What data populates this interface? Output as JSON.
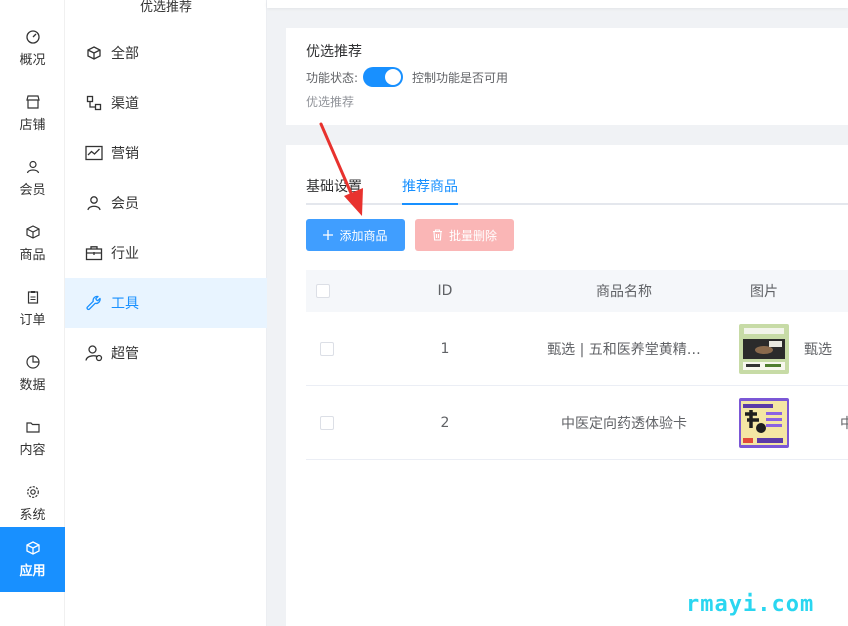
{
  "rail": {
    "items": [
      {
        "label": "概况",
        "icon": "dashboard-icon"
      },
      {
        "label": "店铺",
        "icon": "store-icon"
      },
      {
        "label": "会员",
        "icon": "user-icon"
      },
      {
        "label": "商品",
        "icon": "box-icon"
      },
      {
        "label": "订单",
        "icon": "clipboard-icon"
      },
      {
        "label": "数据",
        "icon": "pie-chart-icon"
      },
      {
        "label": "内容",
        "icon": "folder-icon"
      },
      {
        "label": "系统",
        "icon": "gear-icon"
      },
      {
        "label": "应用",
        "icon": "app-cube-icon",
        "active": true
      }
    ]
  },
  "submenu": {
    "title": "优选推荐",
    "items": [
      {
        "label": "全部",
        "icon": "cube-icon"
      },
      {
        "label": "渠道",
        "icon": "channel-icon"
      },
      {
        "label": "营销",
        "icon": "trend-icon"
      },
      {
        "label": "会员",
        "icon": "user-icon"
      },
      {
        "label": "行业",
        "icon": "briefcase-icon"
      },
      {
        "label": "工具",
        "icon": "wrench-icon",
        "active": true
      },
      {
        "label": "超管",
        "icon": "admin-icon"
      }
    ]
  },
  "feature": {
    "title": "优选推荐",
    "status_label": "功能状态:",
    "toggle_on": true,
    "status_hint": "控制功能是否可用",
    "desc": "优选推荐"
  },
  "tabs": [
    {
      "label": "基础设置"
    },
    {
      "label": "推荐商品",
      "active": true
    }
  ],
  "buttons": {
    "add": "添加商品",
    "batch_delete": "批量删除"
  },
  "table": {
    "headers": {
      "id": "ID",
      "name": "商品名称",
      "image": "图片"
    },
    "rows": [
      {
        "id": "1",
        "name": "甄选 | 五和医养堂黄精…",
        "extra": "甄选"
      },
      {
        "id": "2",
        "name": "中医定向药透体验卡",
        "extra": "中"
      }
    ]
  },
  "colors": {
    "primary": "#1890ff",
    "button_blue": "#409eff",
    "button_disabled_red": "#fab6b6",
    "annotation_red": "#e8322e"
  },
  "watermark": "rmayi.com"
}
